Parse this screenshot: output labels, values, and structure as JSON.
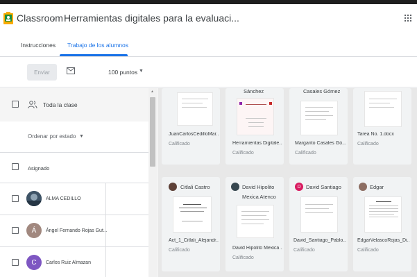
{
  "header": {
    "app_title": "Classroom",
    "separator": "›",
    "assignment_title": "Herramientas digitales para la evaluaci..."
  },
  "tabs": [
    {
      "label": "Instrucciones"
    },
    {
      "label": "Trabajo de los alumnos"
    }
  ],
  "toolbar": {
    "send_label": "Enviar",
    "points_value": "100 puntos"
  },
  "left_panel": {
    "all_class_label": "Toda la clase",
    "sort_label": "Ordenar por estado",
    "group_label": "Asignado",
    "students": [
      {
        "name": "ALMA CEDILLO"
      },
      {
        "name": "Ángel Fernando Rojas Gut..."
      },
      {
        "name": "Carlos Ruiz Almazan",
        "initial": "C"
      }
    ],
    "angel_initial": "Á"
  },
  "cards_row1": [
    {
      "top_name": "",
      "file": "JuanCarlosCedilloMar...",
      "status": "Calificado"
    },
    {
      "top_name": "Sánchez",
      "file": "Herramientas Digitale...",
      "status": "Calificado"
    },
    {
      "top_name": "Casales Gómez",
      "file": "Margarito Casales Gó...",
      "status": "Calificado"
    },
    {
      "top_name": "",
      "file": "Tarea No. 1.docx",
      "status": "Calificado"
    }
  ],
  "cards_row2": [
    {
      "name": "Citlali Castro",
      "file": "Act_1_Citlali_Alejandr...",
      "status": "Calificado"
    },
    {
      "name": "David Hipolito",
      "name2": "Mexica Atenco",
      "file": "David Hipolito Mexica ...",
      "status": "Calificado"
    },
    {
      "name": "David Santiago",
      "initial": "D",
      "file": "David_Santiago_Pablo...",
      "status": "Calificado"
    },
    {
      "name": "Edgar",
      "file": "EdgarVelascoRojas_Di...",
      "status": "Calificado"
    }
  ],
  "colors": {
    "accent": "#1a73e8",
    "avatar_angel": "#a1887f",
    "avatar_carlos": "#7e57c2",
    "avatar_david_santiago": "#d81b60"
  }
}
